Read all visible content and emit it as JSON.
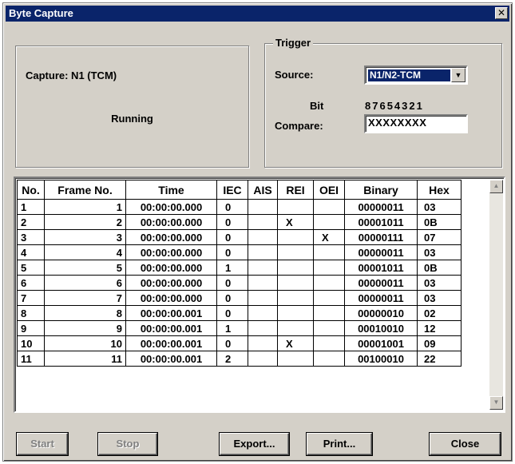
{
  "window": {
    "title": "Byte Capture",
    "close_glyph": "✕"
  },
  "capture": {
    "label": "Capture:  N1 (TCM)",
    "status": "Running"
  },
  "trigger": {
    "caption": "Trigger",
    "source_label": "Source:",
    "source_value": "N1/N2-TCM",
    "bit_label": "Bit",
    "bit_pattern": "87654321",
    "compare_label": "Compare:",
    "compare_value": "XXXXXXXX"
  },
  "table": {
    "headers": [
      "No.",
      "Frame No.",
      "Time",
      "IEC",
      "AIS",
      "REI",
      "OEI",
      "Binary",
      "Hex"
    ],
    "rows": [
      {
        "no": "1",
        "frame": "1",
        "time": "00:00:00.000",
        "iec": "0",
        "ais": "",
        "rei": "",
        "oei": "",
        "binary": "00000011",
        "hex": "03"
      },
      {
        "no": "2",
        "frame": "2",
        "time": "00:00:00.000",
        "iec": "0",
        "ais": "",
        "rei": "X",
        "oei": "",
        "binary": "00001011",
        "hex": "0B"
      },
      {
        "no": "3",
        "frame": "3",
        "time": "00:00:00.000",
        "iec": "0",
        "ais": "",
        "rei": "",
        "oei": "X",
        "binary": "00000111",
        "hex": "07"
      },
      {
        "no": "4",
        "frame": "4",
        "time": "00:00:00.000",
        "iec": "0",
        "ais": "",
        "rei": "",
        "oei": "",
        "binary": "00000011",
        "hex": "03"
      },
      {
        "no": "5",
        "frame": "5",
        "time": "00:00:00.000",
        "iec": "1",
        "ais": "",
        "rei": "",
        "oei": "",
        "binary": "00001011",
        "hex": "0B"
      },
      {
        "no": "6",
        "frame": "6",
        "time": "00:00:00.000",
        "iec": "0",
        "ais": "",
        "rei": "",
        "oei": "",
        "binary": "00000011",
        "hex": "03"
      },
      {
        "no": "7",
        "frame": "7",
        "time": "00:00:00.000",
        "iec": "0",
        "ais": "",
        "rei": "",
        "oei": "",
        "binary": "00000011",
        "hex": "03"
      },
      {
        "no": "8",
        "frame": "8",
        "time": "00:00:00.001",
        "iec": "0",
        "ais": "",
        "rei": "",
        "oei": "",
        "binary": "00000010",
        "hex": "02"
      },
      {
        "no": "9",
        "frame": "9",
        "time": "00:00:00.001",
        "iec": "1",
        "ais": "",
        "rei": "",
        "oei": "",
        "binary": "00010010",
        "hex": "12"
      },
      {
        "no": "10",
        "frame": "10",
        "time": "00:00:00.001",
        "iec": "0",
        "ais": "",
        "rei": "X",
        "oei": "",
        "binary": "00001001",
        "hex": "09"
      },
      {
        "no": "11",
        "frame": "11",
        "time": "00:00:00.001",
        "iec": "2",
        "ais": "",
        "rei": "",
        "oei": "",
        "binary": "00100010",
        "hex": "22"
      }
    ]
  },
  "buttons": {
    "start": "Start",
    "stop": "Stop",
    "export": "Export...",
    "print": "Print...",
    "close": "Close"
  },
  "icons": {
    "dropdown": "chevron-down-icon",
    "scroll_up": "scroll-up-arrow-icon",
    "scroll_down": "scroll-down-arrow-icon",
    "close": "close-icon"
  },
  "colors": {
    "titlebar": "#0a246a",
    "face": "#d4d0c8",
    "selection": "#0a246a"
  }
}
